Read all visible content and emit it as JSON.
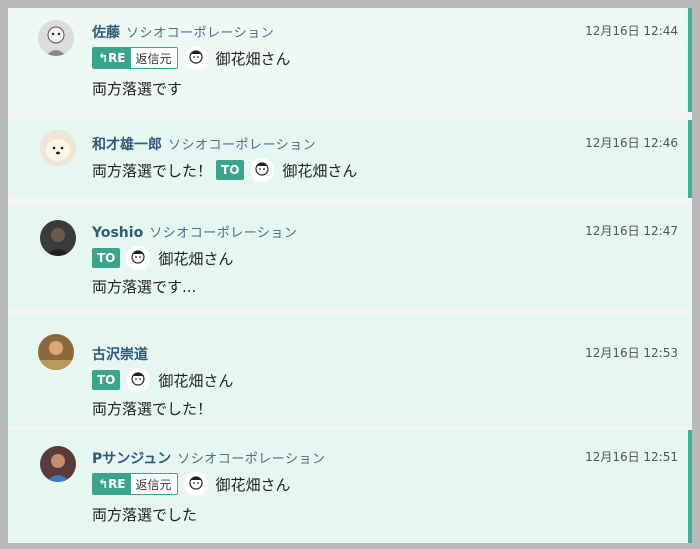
{
  "messages": [
    {
      "name": "佐藤",
      "org": "ソシオコーポレーション",
      "time": "12月16日 12:44",
      "tag": "RE",
      "tag_label": "RE",
      "tag_src": "返信元",
      "mention": "御花畑さん",
      "body": "両方落選です"
    },
    {
      "name": "和才雄一郎",
      "org": "ソシオコーポレーション",
      "time": "12月16日 12:46",
      "tag": "TO",
      "tag_label": "TO",
      "mention": "御花畑さん",
      "body": "両方落選でした！"
    },
    {
      "name": "Yoshio",
      "org": "ソシオコーポレーション",
      "time": "12月16日 12:47",
      "tag": "TO",
      "tag_label": "TO",
      "mention": "御花畑さん",
      "body": "両方落選です..."
    },
    {
      "name": "古沢崇道",
      "org": "",
      "time": "12月16日 12:53",
      "tag": "TO",
      "tag_label": "TO",
      "mention": "御花畑さん",
      "body": "両方落選でした！"
    },
    {
      "name": "Pサンジュン",
      "org": "ソシオコーポレーション",
      "time": "12月16日 12:51",
      "tag": "RE",
      "tag_label": "RE",
      "tag_src": "返信元",
      "mention": "御花畑さん",
      "body": "両方落選でした"
    }
  ],
  "colors": {
    "accent": "#3bb39a",
    "tag": "#3aa58a",
    "name": "#2f5a7a",
    "bg": "#e6f7f2"
  }
}
